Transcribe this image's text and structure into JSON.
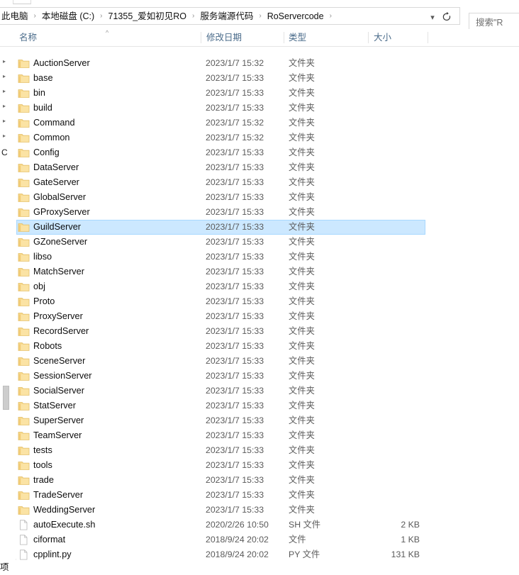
{
  "window": {
    "tab_strip_visible": true
  },
  "address_bar": {
    "breadcrumbs": [
      "此电脑",
      "本地磁盘 (C:)",
      "71355_爱如初见RO",
      "服务端源代码",
      "RoServercode"
    ],
    "separator": "›",
    "dropdown_icon": "chevron-down-icon",
    "refresh_icon": "refresh-icon"
  },
  "search": {
    "value": "搜索\"R"
  },
  "columns": {
    "name": "名称",
    "date_modified": "修改日期",
    "type": "类型",
    "size": "大小",
    "sort_caret": "^"
  },
  "nav_pane": {
    "chevron": "›",
    "partial_label": "C"
  },
  "status_bar": {
    "text": "项"
  },
  "colors": {
    "selection_fill": "#cce8ff",
    "selection_border": "#a8d8ff",
    "folder_icon": "#f6d37f",
    "header_text": "#4a6b8a"
  },
  "files": [
    {
      "name": "AuctionServer",
      "date": "2023/1/7 15:32",
      "type": "文件夹",
      "size": "",
      "icon": "folder-icon",
      "selected": false
    },
    {
      "name": "base",
      "date": "2023/1/7 15:33",
      "type": "文件夹",
      "size": "",
      "icon": "folder-icon",
      "selected": false
    },
    {
      "name": "bin",
      "date": "2023/1/7 15:33",
      "type": "文件夹",
      "size": "",
      "icon": "folder-icon",
      "selected": false
    },
    {
      "name": "build",
      "date": "2023/1/7 15:33",
      "type": "文件夹",
      "size": "",
      "icon": "folder-icon",
      "selected": false
    },
    {
      "name": "Command",
      "date": "2023/1/7 15:32",
      "type": "文件夹",
      "size": "",
      "icon": "folder-icon",
      "selected": false
    },
    {
      "name": "Common",
      "date": "2023/1/7 15:32",
      "type": "文件夹",
      "size": "",
      "icon": "folder-icon",
      "selected": false
    },
    {
      "name": "Config",
      "date": "2023/1/7 15:33",
      "type": "文件夹",
      "size": "",
      "icon": "folder-icon",
      "selected": false
    },
    {
      "name": "DataServer",
      "date": "2023/1/7 15:33",
      "type": "文件夹",
      "size": "",
      "icon": "folder-icon",
      "selected": false
    },
    {
      "name": "GateServer",
      "date": "2023/1/7 15:33",
      "type": "文件夹",
      "size": "",
      "icon": "folder-icon",
      "selected": false
    },
    {
      "name": "GlobalServer",
      "date": "2023/1/7 15:33",
      "type": "文件夹",
      "size": "",
      "icon": "folder-icon",
      "selected": false
    },
    {
      "name": "GProxyServer",
      "date": "2023/1/7 15:33",
      "type": "文件夹",
      "size": "",
      "icon": "folder-icon",
      "selected": false
    },
    {
      "name": "GuildServer",
      "date": "2023/1/7 15:33",
      "type": "文件夹",
      "size": "",
      "icon": "folder-icon",
      "selected": true
    },
    {
      "name": "GZoneServer",
      "date": "2023/1/7 15:33",
      "type": "文件夹",
      "size": "",
      "icon": "folder-icon",
      "selected": false
    },
    {
      "name": "libso",
      "date": "2023/1/7 15:33",
      "type": "文件夹",
      "size": "",
      "icon": "folder-icon",
      "selected": false
    },
    {
      "name": "MatchServer",
      "date": "2023/1/7 15:33",
      "type": "文件夹",
      "size": "",
      "icon": "folder-icon",
      "selected": false
    },
    {
      "name": "obj",
      "date": "2023/1/7 15:33",
      "type": "文件夹",
      "size": "",
      "icon": "folder-icon",
      "selected": false
    },
    {
      "name": "Proto",
      "date": "2023/1/7 15:33",
      "type": "文件夹",
      "size": "",
      "icon": "folder-icon",
      "selected": false
    },
    {
      "name": "ProxyServer",
      "date": "2023/1/7 15:33",
      "type": "文件夹",
      "size": "",
      "icon": "folder-icon",
      "selected": false
    },
    {
      "name": "RecordServer",
      "date": "2023/1/7 15:33",
      "type": "文件夹",
      "size": "",
      "icon": "folder-icon",
      "selected": false
    },
    {
      "name": "Robots",
      "date": "2023/1/7 15:33",
      "type": "文件夹",
      "size": "",
      "icon": "folder-icon",
      "selected": false
    },
    {
      "name": "SceneServer",
      "date": "2023/1/7 15:33",
      "type": "文件夹",
      "size": "",
      "icon": "folder-icon",
      "selected": false
    },
    {
      "name": "SessionServer",
      "date": "2023/1/7 15:33",
      "type": "文件夹",
      "size": "",
      "icon": "folder-icon",
      "selected": false
    },
    {
      "name": "SocialServer",
      "date": "2023/1/7 15:33",
      "type": "文件夹",
      "size": "",
      "icon": "folder-icon",
      "selected": false
    },
    {
      "name": "StatServer",
      "date": "2023/1/7 15:33",
      "type": "文件夹",
      "size": "",
      "icon": "folder-icon",
      "selected": false
    },
    {
      "name": "SuperServer",
      "date": "2023/1/7 15:33",
      "type": "文件夹",
      "size": "",
      "icon": "folder-icon",
      "selected": false
    },
    {
      "name": "TeamServer",
      "date": "2023/1/7 15:33",
      "type": "文件夹",
      "size": "",
      "icon": "folder-icon",
      "selected": false
    },
    {
      "name": "tests",
      "date": "2023/1/7 15:33",
      "type": "文件夹",
      "size": "",
      "icon": "folder-icon",
      "selected": false
    },
    {
      "name": "tools",
      "date": "2023/1/7 15:33",
      "type": "文件夹",
      "size": "",
      "icon": "folder-icon",
      "selected": false
    },
    {
      "name": "trade",
      "date": "2023/1/7 15:33",
      "type": "文件夹",
      "size": "",
      "icon": "folder-icon",
      "selected": false
    },
    {
      "name": "TradeServer",
      "date": "2023/1/7 15:33",
      "type": "文件夹",
      "size": "",
      "icon": "folder-icon",
      "selected": false
    },
    {
      "name": "WeddingServer",
      "date": "2023/1/7 15:33",
      "type": "文件夹",
      "size": "",
      "icon": "folder-icon",
      "selected": false
    },
    {
      "name": "autoExecute.sh",
      "date": "2020/2/26 10:50",
      "type": "SH 文件",
      "size": "2 KB",
      "icon": "file-icon",
      "selected": false
    },
    {
      "name": "ciformat",
      "date": "2018/9/24 20:02",
      "type": "文件",
      "size": "1 KB",
      "icon": "file-icon",
      "selected": false
    },
    {
      "name": "cpplint.py",
      "date": "2018/9/24 20:02",
      "type": "PY 文件",
      "size": "131 KB",
      "icon": "file-icon",
      "selected": false
    }
  ]
}
